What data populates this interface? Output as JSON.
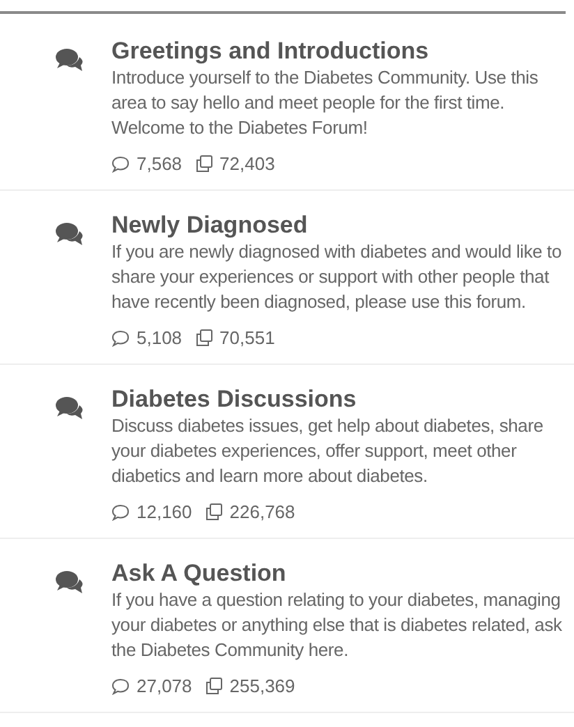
{
  "forums": [
    {
      "title": "Greetings and Introductions",
      "description": "Introduce yourself to the Diabetes Community. Use this area to say hello and meet people for the first time. Welcome to the Diabetes Forum!",
      "threads": "7,568",
      "messages": "72,403"
    },
    {
      "title": "Newly Diagnosed",
      "description": "If you are newly diagnosed with diabetes and would like to share your experiences or support with other people that have recently been diagnosed, please use this forum.",
      "threads": "5,108",
      "messages": "70,551"
    },
    {
      "title": "Diabetes Discussions",
      "description": "Discuss diabetes issues, get help about diabetes, share your diabetes experiences, offer support, meet other diabetics and learn more about diabetes.",
      "threads": "12,160",
      "messages": "226,768"
    },
    {
      "title": "Ask A Question",
      "description": "If you have a question relating to your diabetes, managing your diabetes or anything else that is diabetes related, ask the Diabetes Community here.",
      "threads": "27,078",
      "messages": "255,369"
    }
  ]
}
